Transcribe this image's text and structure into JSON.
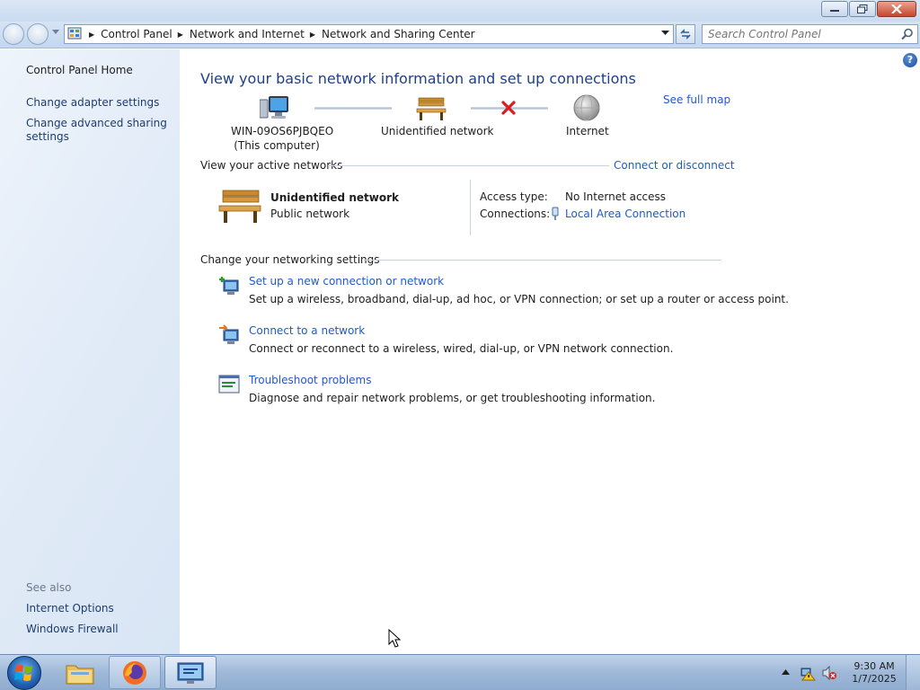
{
  "addressbar": {
    "crumbs": [
      "Control Panel",
      "Network and Internet",
      "Network and Sharing Center"
    ]
  },
  "search": {
    "placeholder": "Search Control Panel"
  },
  "leftpane": {
    "home": "Control Panel Home",
    "adapter": "Change adapter settings",
    "sharing_line1": "Change advanced sharing",
    "sharing_line2": "settings",
    "see_also": "See also",
    "internet_options": "Internet Options",
    "firewall": "Windows Firewall"
  },
  "main": {
    "title": "View your basic network information and set up connections",
    "see_full_map": "See full map",
    "map": {
      "computer_name": "WIN-09OS6PJBQEO",
      "computer_sub": "(This computer)",
      "network": "Unidentified network",
      "internet": "Internet"
    },
    "active_networks": {
      "title": "View your active networks",
      "connect_link": "Connect or disconnect",
      "network_name": "Unidentified network",
      "network_type": "Public network",
      "access_label": "Access type:",
      "access_value": "No Internet access",
      "connections_label": "Connections:",
      "connections_value": "Local Area Connection"
    },
    "settings": {
      "title": "Change your networking settings",
      "items": [
        {
          "link": "Set up a new connection or network",
          "desc": "Set up a wireless, broadband, dial-up, ad hoc, or VPN connection; or set up a router or access point.",
          "icon": "new-connection-icon"
        },
        {
          "link": "Connect to a network",
          "desc": "Connect or reconnect to a wireless, wired, dial-up, or VPN network connection.",
          "icon": "connect-network-icon"
        },
        {
          "link": "Troubleshoot problems",
          "desc": "Diagnose and repair network problems, or get troubleshooting information.",
          "icon": "troubleshoot-icon"
        }
      ]
    }
  },
  "taskbar": {
    "time": "9:30 AM",
    "date": "1/7/2025"
  },
  "colors": {
    "link": "#1f5ac7",
    "title": "#1e3f8a",
    "error_x": "#d81e1e"
  }
}
